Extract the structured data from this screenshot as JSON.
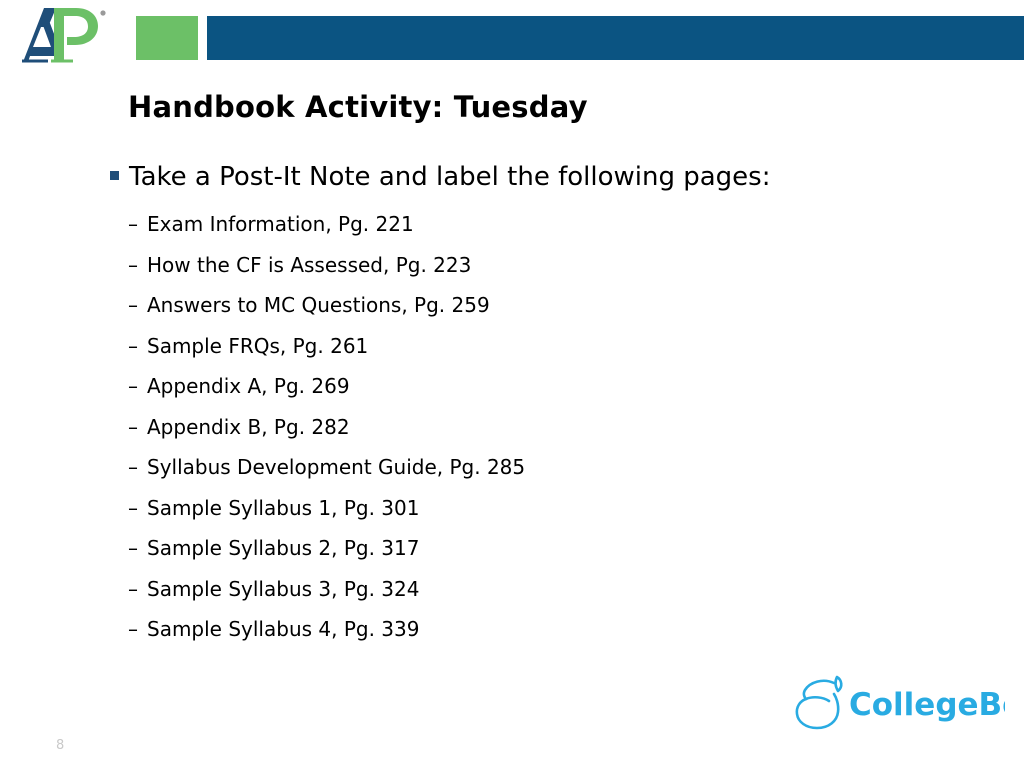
{
  "slide": {
    "page_number": "8",
    "title": "Handbook Activity: Tuesday"
  },
  "branding": {
    "ap_logo_text": "AP",
    "ap_logo_trademark": "®",
    "ap_blue": "#1f4e79",
    "ap_green": "#6cc067",
    "header_blue": "#0b5482",
    "collegeboard_name": "CollegeBoard",
    "collegeboard_blue": "#29abe2",
    "acorn_icon_name": "acorn-icon"
  },
  "body": {
    "lead_bullet_marker": "▪",
    "lead_bullet": "Take a Post-It Note and label the following pages:",
    "sub_bullet_marker": "–",
    "items": [
      "Exam Information, Pg. 221",
      "How the CF is Assessed, Pg. 223",
      "Answers to MC Questions, Pg. 259",
      "Sample FRQs, Pg. 261",
      "Appendix A, Pg. 269",
      "Appendix B, Pg. 282",
      "Syllabus Development Guide, Pg. 285",
      "Sample Syllabus 1, Pg. 301",
      "Sample Syllabus 2, Pg. 317",
      "Sample Syllabus 3, Pg. 324",
      "Sample Syllabus 4, Pg. 339"
    ]
  }
}
